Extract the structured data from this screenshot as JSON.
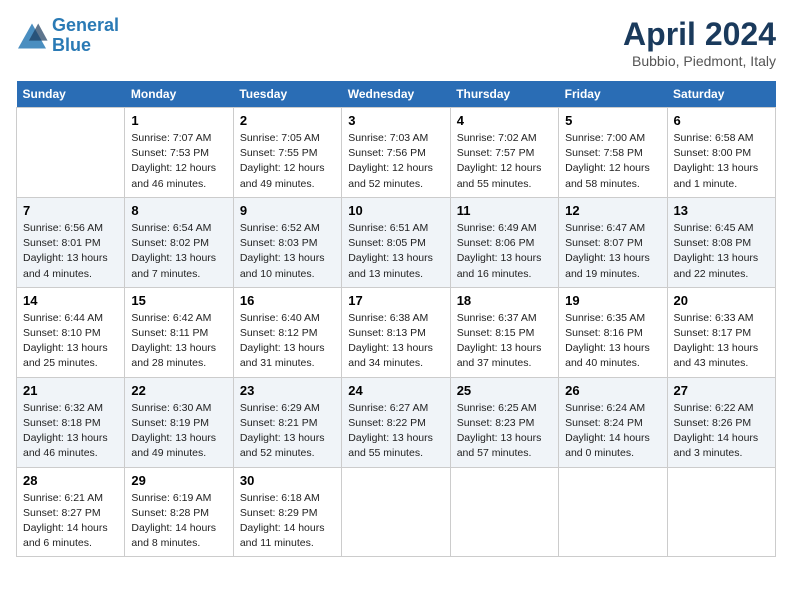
{
  "header": {
    "logo_line1": "General",
    "logo_line2": "Blue",
    "month_title": "April 2024",
    "location": "Bubbio, Piedmont, Italy"
  },
  "columns": [
    "Sunday",
    "Monday",
    "Tuesday",
    "Wednesday",
    "Thursday",
    "Friday",
    "Saturday"
  ],
  "weeks": [
    [
      {
        "day": "",
        "info": ""
      },
      {
        "day": "1",
        "info": "Sunrise: 7:07 AM\nSunset: 7:53 PM\nDaylight: 12 hours\nand 46 minutes."
      },
      {
        "day": "2",
        "info": "Sunrise: 7:05 AM\nSunset: 7:55 PM\nDaylight: 12 hours\nand 49 minutes."
      },
      {
        "day": "3",
        "info": "Sunrise: 7:03 AM\nSunset: 7:56 PM\nDaylight: 12 hours\nand 52 minutes."
      },
      {
        "day": "4",
        "info": "Sunrise: 7:02 AM\nSunset: 7:57 PM\nDaylight: 12 hours\nand 55 minutes."
      },
      {
        "day": "5",
        "info": "Sunrise: 7:00 AM\nSunset: 7:58 PM\nDaylight: 12 hours\nand 58 minutes."
      },
      {
        "day": "6",
        "info": "Sunrise: 6:58 AM\nSunset: 8:00 PM\nDaylight: 13 hours\nand 1 minute."
      }
    ],
    [
      {
        "day": "7",
        "info": "Sunrise: 6:56 AM\nSunset: 8:01 PM\nDaylight: 13 hours\nand 4 minutes."
      },
      {
        "day": "8",
        "info": "Sunrise: 6:54 AM\nSunset: 8:02 PM\nDaylight: 13 hours\nand 7 minutes."
      },
      {
        "day": "9",
        "info": "Sunrise: 6:52 AM\nSunset: 8:03 PM\nDaylight: 13 hours\nand 10 minutes."
      },
      {
        "day": "10",
        "info": "Sunrise: 6:51 AM\nSunset: 8:05 PM\nDaylight: 13 hours\nand 13 minutes."
      },
      {
        "day": "11",
        "info": "Sunrise: 6:49 AM\nSunset: 8:06 PM\nDaylight: 13 hours\nand 16 minutes."
      },
      {
        "day": "12",
        "info": "Sunrise: 6:47 AM\nSunset: 8:07 PM\nDaylight: 13 hours\nand 19 minutes."
      },
      {
        "day": "13",
        "info": "Sunrise: 6:45 AM\nSunset: 8:08 PM\nDaylight: 13 hours\nand 22 minutes."
      }
    ],
    [
      {
        "day": "14",
        "info": "Sunrise: 6:44 AM\nSunset: 8:10 PM\nDaylight: 13 hours\nand 25 minutes."
      },
      {
        "day": "15",
        "info": "Sunrise: 6:42 AM\nSunset: 8:11 PM\nDaylight: 13 hours\nand 28 minutes."
      },
      {
        "day": "16",
        "info": "Sunrise: 6:40 AM\nSunset: 8:12 PM\nDaylight: 13 hours\nand 31 minutes."
      },
      {
        "day": "17",
        "info": "Sunrise: 6:38 AM\nSunset: 8:13 PM\nDaylight: 13 hours\nand 34 minutes."
      },
      {
        "day": "18",
        "info": "Sunrise: 6:37 AM\nSunset: 8:15 PM\nDaylight: 13 hours\nand 37 minutes."
      },
      {
        "day": "19",
        "info": "Sunrise: 6:35 AM\nSunset: 8:16 PM\nDaylight: 13 hours\nand 40 minutes."
      },
      {
        "day": "20",
        "info": "Sunrise: 6:33 AM\nSunset: 8:17 PM\nDaylight: 13 hours\nand 43 minutes."
      }
    ],
    [
      {
        "day": "21",
        "info": "Sunrise: 6:32 AM\nSunset: 8:18 PM\nDaylight: 13 hours\nand 46 minutes."
      },
      {
        "day": "22",
        "info": "Sunrise: 6:30 AM\nSunset: 8:19 PM\nDaylight: 13 hours\nand 49 minutes."
      },
      {
        "day": "23",
        "info": "Sunrise: 6:29 AM\nSunset: 8:21 PM\nDaylight: 13 hours\nand 52 minutes."
      },
      {
        "day": "24",
        "info": "Sunrise: 6:27 AM\nSunset: 8:22 PM\nDaylight: 13 hours\nand 55 minutes."
      },
      {
        "day": "25",
        "info": "Sunrise: 6:25 AM\nSunset: 8:23 PM\nDaylight: 13 hours\nand 57 minutes."
      },
      {
        "day": "26",
        "info": "Sunrise: 6:24 AM\nSunset: 8:24 PM\nDaylight: 14 hours\nand 0 minutes."
      },
      {
        "day": "27",
        "info": "Sunrise: 6:22 AM\nSunset: 8:26 PM\nDaylight: 14 hours\nand 3 minutes."
      }
    ],
    [
      {
        "day": "28",
        "info": "Sunrise: 6:21 AM\nSunset: 8:27 PM\nDaylight: 14 hours\nand 6 minutes."
      },
      {
        "day": "29",
        "info": "Sunrise: 6:19 AM\nSunset: 8:28 PM\nDaylight: 14 hours\nand 8 minutes."
      },
      {
        "day": "30",
        "info": "Sunrise: 6:18 AM\nSunset: 8:29 PM\nDaylight: 14 hours\nand 11 minutes."
      },
      {
        "day": "",
        "info": ""
      },
      {
        "day": "",
        "info": ""
      },
      {
        "day": "",
        "info": ""
      },
      {
        "day": "",
        "info": ""
      }
    ]
  ]
}
